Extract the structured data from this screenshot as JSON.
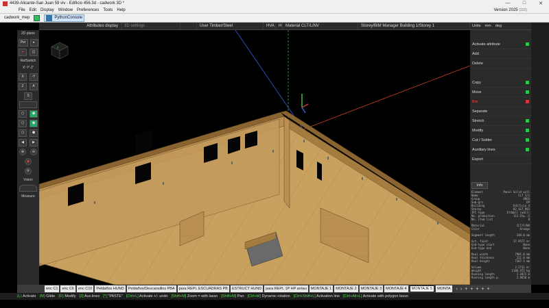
{
  "window": {
    "title": "4439-Alicante-San Juan 59 viv - Edificio 456.3d - cadwork 3D *",
    "controls": [
      "—",
      "□",
      "✕"
    ]
  },
  "menu": {
    "items": [
      "File",
      "Edit",
      "Display",
      "Window",
      "Preferences",
      "Tools",
      "Help"
    ],
    "version": "Version 2025",
    "version_detail": "(222)"
  },
  "toolbar": {
    "item1": "cadwork_mep",
    "item2": "PythonConsole"
  },
  "attrbar": {
    "attributes_display": "Attributes display",
    "settings_3d": "3D settings",
    "user": "User Timber/Steel",
    "hva": "HVA",
    "h": "H",
    "material": "Material CLT/L/NV",
    "storey": "Storey/BIM Manager Building 1/Storey 1"
  },
  "left": {
    "label_2d": "2D plane",
    "per": "Per",
    "refswitch": "RefSwitch",
    "xyz": "X'-Y'-Z'",
    "x": "X",
    "neg_y": "-Y",
    "z": "Z",
    "a": "A",
    "s": "S",
    "vision": "Vision",
    "measure": "Measure"
  },
  "right": {
    "units": "Units",
    "mm": "mm",
    "deg": "deg",
    "buttons": [
      {
        "label": "Activate attribute",
        "ind": "green"
      },
      {
        "label": "Add",
        "ind": "none"
      },
      {
        "label": "Delete",
        "ind": "none"
      },
      {
        "label": "",
        "ind": "none"
      },
      {
        "label": "Copy",
        "ind": "green"
      },
      {
        "label": "Move",
        "ind": "green"
      },
      {
        "label": "Brk",
        "ind": "red"
      },
      {
        "label": "Separate",
        "ind": "none"
      },
      {
        "label": "Stretch",
        "ind": "green"
      },
      {
        "label": "Modify",
        "ind": "green"
      },
      {
        "label": "Cut / Solder",
        "ind": "green"
      },
      {
        "label": "Auxiliary lines",
        "ind": "green"
      },
      {
        "label": "Export",
        "ind": "none"
      }
    ],
    "info_label": "Info",
    "info_rows": [
      [
        "Element",
        "Panel Solid wall"
      ],
      [
        "Name",
        "CLT 1/1"
      ],
      [
        "Group",
        "OROS"
      ],
      [
        "Sub-gro",
        "DP"
      ],
      [
        "Building",
        "Edificio 4"
      ],
      [
        "Storey",
        "02_SGT_P02"
      ],
      [
        "IFC type",
        "IfcWall (wall)"
      ],
      [
        "No. production",
        "111   Stp.:1"
      ],
      [
        "No. item list",
        "0"
      ],
      [
        "",
        ""
      ],
      [
        "Material",
        "CLT/F/NV"
      ],
      [
        "Color",
        "Orange"
      ],
      [
        "",
        ""
      ],
      [
        "Segment length",
        "140.0 mm"
      ],
      [
        "",
        ""
      ],
      [
        "Act. facet",
        "17.9577 m²"
      ],
      [
        "End-type start",
        "None"
      ],
      [
        "End-type end",
        "None"
      ],
      [
        "",
        ""
      ],
      [
        "Real width",
        "7905.0 mm"
      ],
      [
        "Real thickness",
        "121.0 mm"
      ],
      [
        "Real height",
        "7267.5 mm"
      ],
      [
        "",
        ""
      ],
      [
        "Volume",
        "2.2731 m³"
      ],
      [
        "Weight",
        "1186.972 kg"
      ],
      [
        "Running length",
        "2.2871 m"
      ],
      [
        "Running length p.",
        "2.9658 m"
      ]
    ]
  },
  "tabs": {
    "items": [
      "enc C1",
      "enc C6",
      "enc C10",
      "Peldaños HUND",
      "Peldaños/Descansillos PBA",
      "para REPL ESCUADRAS PB",
      "ESTRUCT HUND",
      "para REPL 1P HP arriau",
      "MONTAJE 1",
      "MONTAJE 2",
      "MONTAJE 3",
      "MONTAJE 4",
      "MONTAJE 5",
      "MONTA"
    ],
    "active_index": 12,
    "controls": [
      "‹",
      "›",
      "+",
      "+",
      "+",
      "+",
      "+"
    ]
  },
  "status": {
    "items": [
      {
        "key": "(L)",
        "text": "Activate"
      },
      {
        "key": "(M)",
        "text": "Glide"
      },
      {
        "key": "(R)",
        "text": "Modify"
      },
      {
        "key": "[3]",
        "text": "Aux.lines"
      },
      {
        "key": "[^]",
        "text": "\"PASTE\""
      },
      {
        "key": "[Ctrl+L]",
        "text": "Activate +/- undo"
      },
      {
        "key": "[Shift+M]",
        "text": "Zoom = with lasso"
      },
      {
        "key": "[Shift+M]",
        "text": "Pan"
      },
      {
        "key": "[Ctrl+M]",
        "text": "Dynamic rotation"
      },
      {
        "key": "[Ctrl+Shift+L]",
        "text": "Activation line"
      },
      {
        "key": "[Ctrl+Alt+L]",
        "text": "Activate with polygon lasso"
      }
    ]
  },
  "colors": {
    "wood": "#c9a15f",
    "wood_dark": "#a97f42",
    "axis_red": "#d1402a",
    "axis_blue": "#3a5bd9",
    "axis_green": "#3cc33c",
    "ui_bg": "#2b2b2b"
  }
}
